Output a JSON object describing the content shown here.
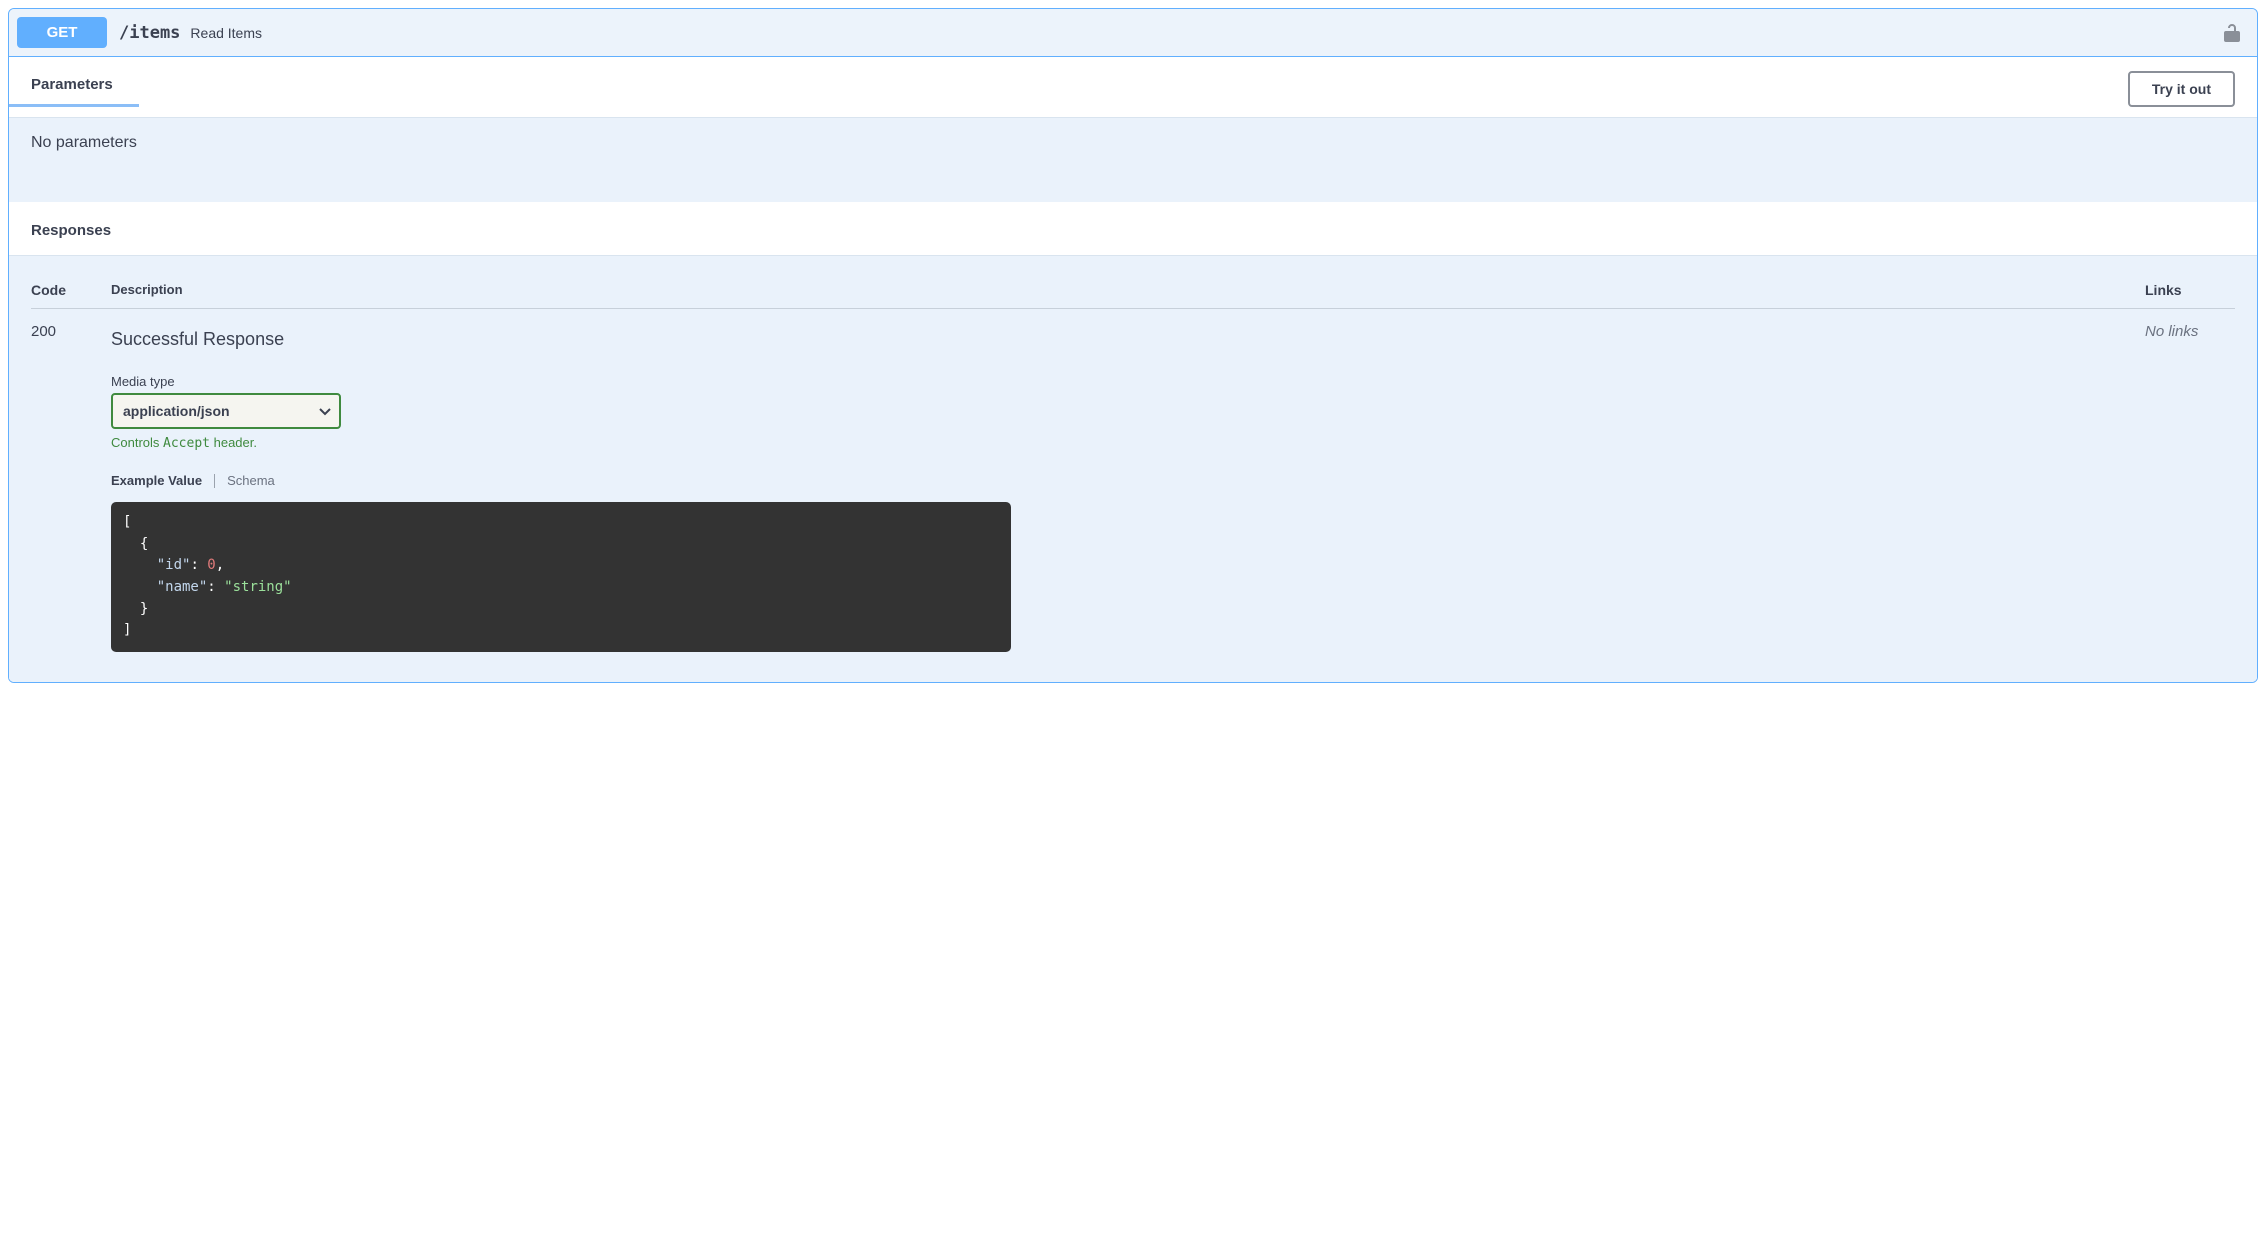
{
  "method": "GET",
  "path": "/items",
  "summary": "Read Items",
  "sections": {
    "parameters_title": "Parameters",
    "try_it_out": "Try it out",
    "no_parameters": "No parameters",
    "responses_title": "Responses"
  },
  "columns": {
    "code": "Code",
    "description": "Description",
    "links": "Links"
  },
  "response": {
    "code": "200",
    "description": "Successful Response",
    "no_links": "No links",
    "media_type_label": "Media type",
    "media_type_selected": "application/json",
    "accept_prefix": "Controls ",
    "accept_code": "Accept",
    "accept_suffix": " header.",
    "tabs": {
      "example": "Example Value",
      "schema": "Schema"
    },
    "example_json": {
      "l1": "[",
      "l2": "  {",
      "l3_key": "\"id\"",
      "l3_val": "0",
      "l4_key": "\"name\"",
      "l4_val": "\"string\"",
      "l5": "  }",
      "l6": "]"
    }
  }
}
